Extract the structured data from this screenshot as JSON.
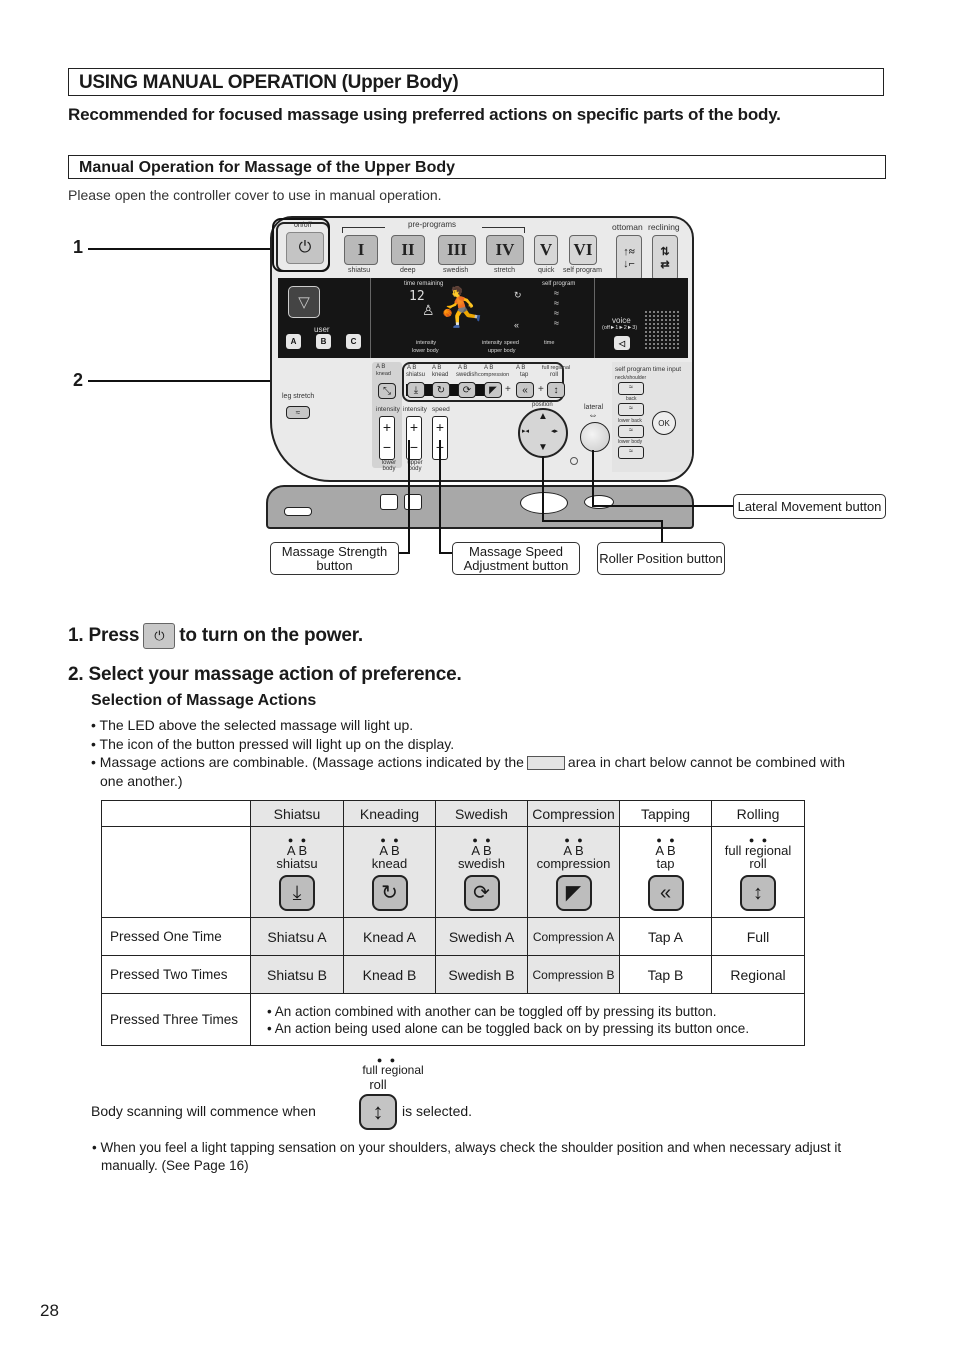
{
  "header": {
    "title": "USING MANUAL OPERATION (Upper Body)",
    "lead": "Recommended for focused massage using preferred actions on specific parts of the body.",
    "section_title": "Manual Operation for Massage of the Upper Body",
    "note": "Please open the controller cover to use in manual operation."
  },
  "controller": {
    "onoff_label": "on/off",
    "power_icon": "power-icon",
    "preprograms_label": "pre-programs",
    "preprograms": [
      {
        "numeral": "I",
        "label": "shiatsu"
      },
      {
        "numeral": "II",
        "label": "deep"
      },
      {
        "numeral": "III",
        "label": "swedish"
      },
      {
        "numeral": "IV",
        "label": "stretch"
      },
      {
        "numeral": "V",
        "label": "quick"
      },
      {
        "numeral": "VI",
        "label": "self program"
      }
    ],
    "ottoman_label": "ottoman",
    "reclining_label": "reclining",
    "display": {
      "time_remaining_label": "time remaining",
      "time_value": "12",
      "self_program_label": "self program",
      "intensity_label": "intensity",
      "lower_body_label": "lower body",
      "intensity2_label": "intensity",
      "speed_label": "speed",
      "upper_body_label": "upper body",
      "time_label": "time"
    },
    "user_label": "user",
    "user_buttons": [
      "A",
      "B",
      "C"
    ],
    "voice_label": "voice",
    "voice_sub": "(off►1►2►3)",
    "leg_stretch_label": "leg stretch",
    "knead_small_label": "knead",
    "actions": [
      {
        "ab": "A  B",
        "label": "shiatsu",
        "icon": "⤓"
      },
      {
        "ab": "A  B",
        "label": "knead",
        "icon": "↻"
      },
      {
        "ab": "A  B",
        "label": "swedish",
        "icon": "⟳"
      },
      {
        "ab": "A  B",
        "label": "compression",
        "icon": "◤"
      },
      {
        "ab": "A  B",
        "label": "tap",
        "icon": "«"
      },
      {
        "ab": "full  regional",
        "label": "roll",
        "icon": "↕"
      }
    ],
    "plus": "+",
    "intensity_lower_label": "intensity",
    "intensity_upper_label": "intensity",
    "speed_ctrl_label": "speed",
    "lower_body_ctrl": "lower body",
    "upper_body_ctrl": "upper body",
    "position_label": "position",
    "lateral_label": "lateral",
    "self_program_time_input": "self program time input",
    "sp_items": [
      "neck/shoulder",
      "back",
      "lower back",
      "lower body"
    ],
    "ok_label": "OK"
  },
  "callouts": {
    "num1": "1",
    "num2": "2",
    "lateral": "Lateral Movement button",
    "strength": "Massage Strength button",
    "speed": "Massage Speed Adjustment button",
    "roller": "Roller Position button"
  },
  "steps": {
    "step1_pre": "1. Press",
    "step1_post": "to turn on the power.",
    "step2": "2. Select your massage action of preference.",
    "subheading": "Selection of Massage Actions",
    "bullets": [
      "• The LED above the selected massage will light up.",
      "• The icon of the button pressed will light up on the display."
    ],
    "bullet3_pre": "• Massage actions are combinable. (Massage actions indicated by the",
    "bullet3_post": "area in chart below cannot be combined with one another.)"
  },
  "table": {
    "columns": [
      "Shiatsu",
      "Kneading",
      "Swedish",
      "Compression",
      "Tapping",
      "Rolling"
    ],
    "icons": [
      {
        "ab": "A   B",
        "name": "shiatsu",
        "glyph": "⤓"
      },
      {
        "ab": "A   B",
        "name": "knead",
        "glyph": "↻"
      },
      {
        "ab": "A   B",
        "name": "swedish",
        "glyph": "⟳"
      },
      {
        "ab": "A   B",
        "name": "compression",
        "glyph": "◤"
      },
      {
        "ab": "A   B",
        "name": "tap",
        "glyph": "«"
      },
      {
        "ab": "full  regional",
        "name": "roll",
        "glyph": "↕"
      }
    ],
    "rows": [
      {
        "label": "Pressed One Time",
        "cells": [
          "Shiatsu A",
          "Knead A",
          "Swedish A",
          "Compression A",
          "Tap A",
          "Full"
        ]
      },
      {
        "label": "Pressed Two Times",
        "cells": [
          "Shiatsu B",
          "Knead B",
          "Swedish B",
          "Compression B",
          "Tap B",
          "Regional"
        ]
      }
    ],
    "row3_label": "Pressed Three Times",
    "row3_notes": [
      "• An action combined with another can be toggled off by pressing its button.",
      "• An action being used alone can be toggled back on by pressing its button once."
    ]
  },
  "scan": {
    "pre": "Body scanning will commence when",
    "post": "is selected.",
    "icon_top": "full  regional",
    "icon_name": "roll",
    "glyph": "↕"
  },
  "tail_note": "• When you feel a light tapping sensation on your shoulders, always check the shoulder position and when necessary adjust it manually. (See Page 16)",
  "page_number": "28"
}
